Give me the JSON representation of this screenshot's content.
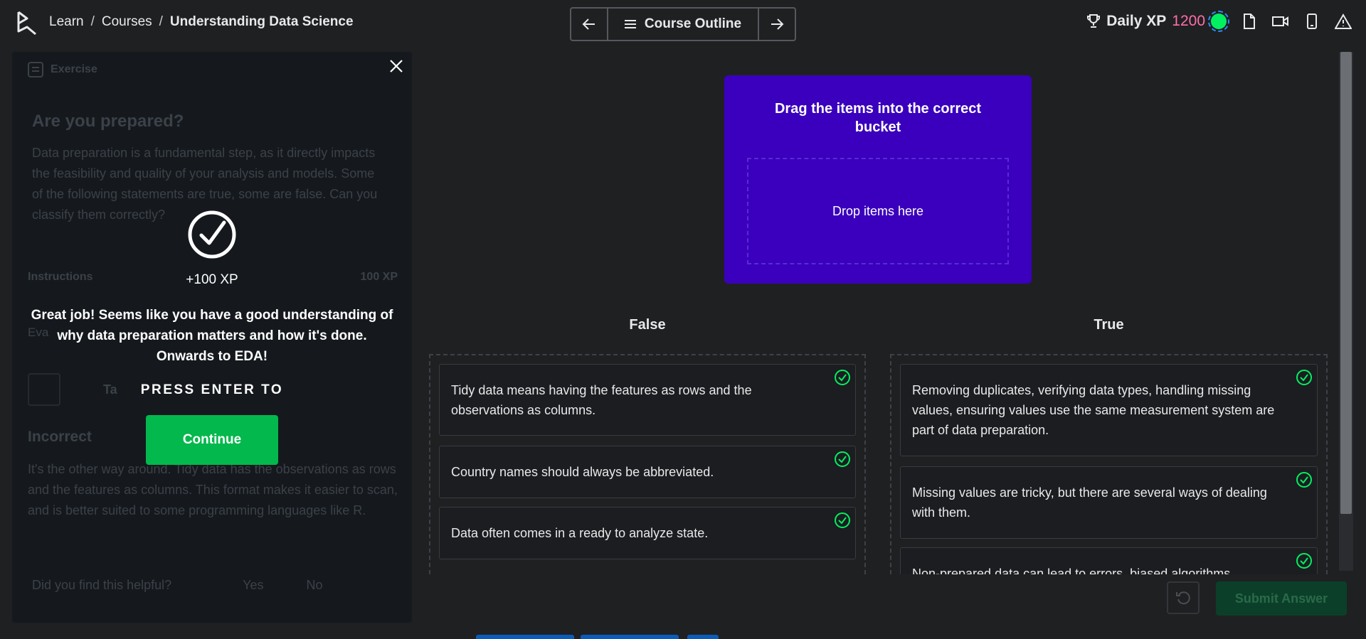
{
  "header": {
    "breadcrumb": [
      "Learn",
      "Courses",
      "Understanding Data Science"
    ],
    "separator": "/",
    "outline_label": "Course Outline",
    "daily_xp_label": "Daily XP",
    "daily_xp_value": "1200",
    "icons": [
      "trophy-icon",
      "document-icon",
      "video-icon",
      "mobile-icon",
      "warning-icon"
    ]
  },
  "left_panel": {
    "exercise_label": "Exercise",
    "title": "Are you prepared?",
    "body": "Data preparation is a fundamental step, as it directly impacts the feasibility and quality of your analysis and models. Some of the following statements are true, some are false. Can you classify them correctly?",
    "instructions_label": "Instructions",
    "instructions_xp": "100 XP",
    "eval_label": "Eva",
    "take_hint_label": "Ta",
    "incorrect_title": "Incorrect",
    "incorrect_text": "It's the other way around. Tidy data has the observations as rows and the features as columns. This format makes it easier to scan, and is better suited to some programming languages like R.",
    "helpful_question": "Did you find this helpful?",
    "yes_label": "Yes",
    "no_label": "No"
  },
  "success_modal": {
    "xp_gain": "+100 XP",
    "message": "Great job! Seems like you have a good understanding of why data preparation matters and how it's done. Onwards to EDA!",
    "press_enter": "PRESS ENTER TO",
    "continue_label": "Continue"
  },
  "drag_card": {
    "title": "Drag the items into the correct bucket",
    "drop_placeholder": "Drop items here"
  },
  "buckets": {
    "false": {
      "title": "False",
      "items": [
        "Tidy data means having the features as rows and the observations as columns.",
        "Country names should always be abbreviated.",
        "Data often comes in a ready to analyze state."
      ]
    },
    "true": {
      "title": "True",
      "items": [
        "Removing duplicates, verifying data types, handling missing values, ensuring values use the same measurement system are part of data preparation.",
        "Missing values are tricky, but there are several ways of dealing with them.",
        "Non-prepared data can lead to errors, biased algorithms..."
      ]
    }
  },
  "actions": {
    "submit_label": "Submit Answer"
  },
  "colors": {
    "accent_green": "#03ef62",
    "xp_pink": "#ff6ea9",
    "drag_card_purple": "#3a00bd",
    "continue_green": "#03b84c"
  }
}
